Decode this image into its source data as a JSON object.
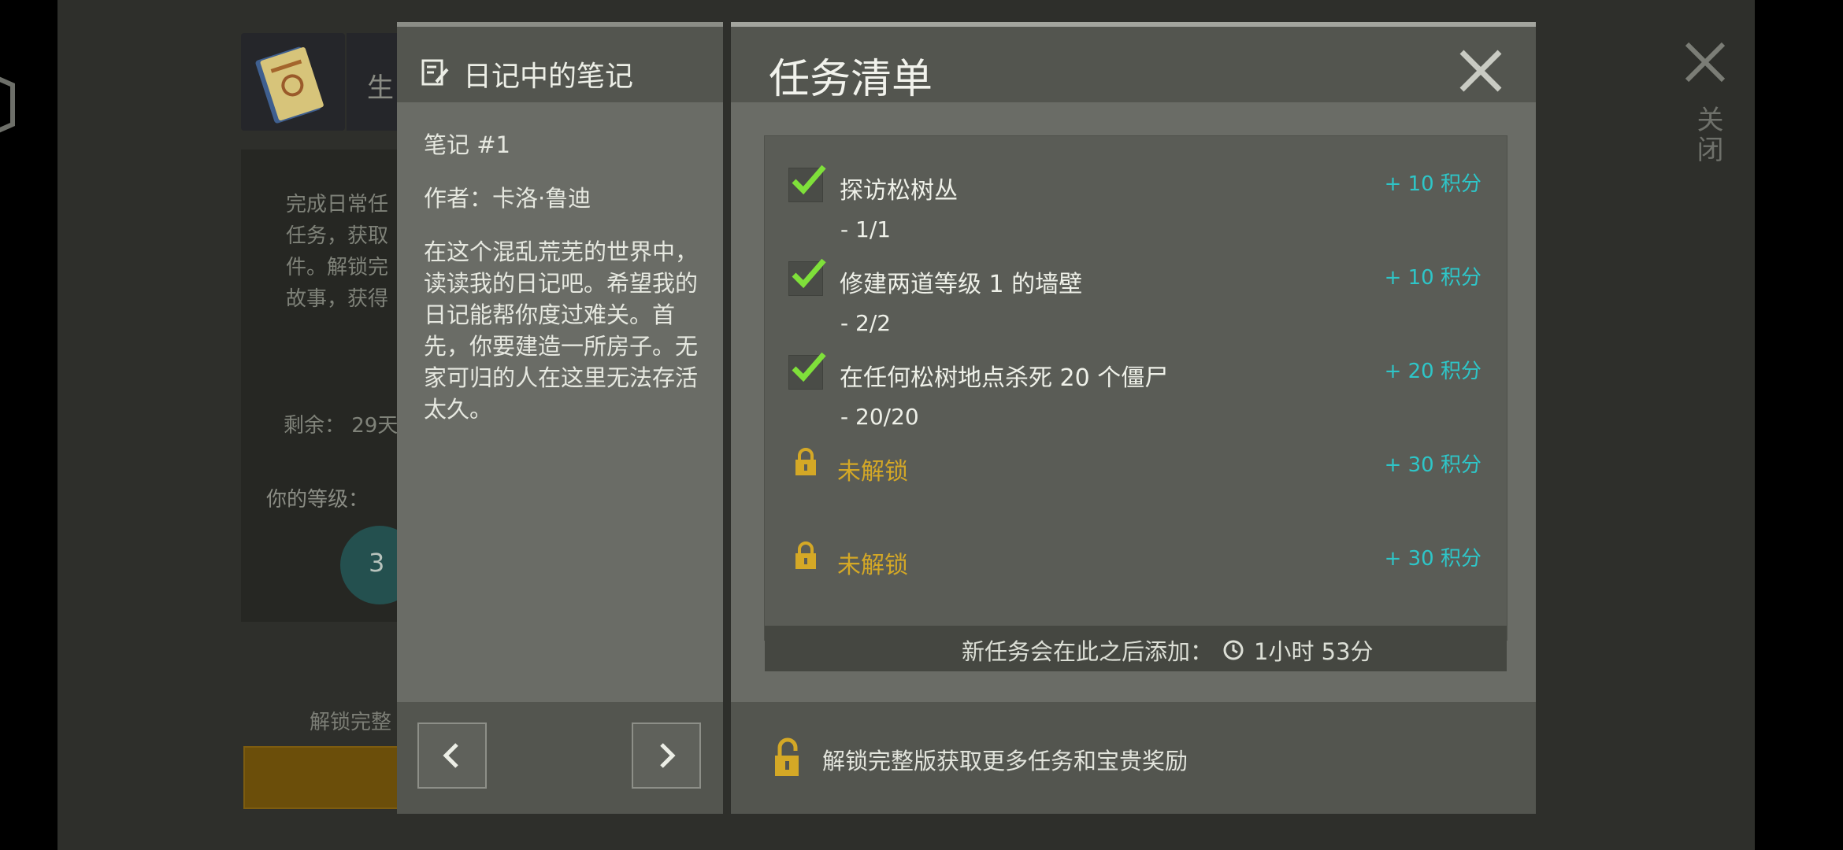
{
  "background": {
    "title": "生",
    "description": "完成日常任\n任务，获取\n件。解锁完\n故事，获得",
    "remaining": "剩余： 29天",
    "level_label": "你的等级：",
    "level_value": "3",
    "unlock_text": "解锁完整"
  },
  "right_close": {
    "label": "关闭"
  },
  "diary": {
    "title": "日记中的笔记",
    "note_number": "笔记 #1",
    "author": "作者：卡洛·鲁迪",
    "content": "在这个混乱荒芜的世界中，读读我的日记吧。希望我的日记能帮你度过难关。首先，你要建造一所房子。无家可归的人在这里无法存活太久。"
  },
  "task_list": {
    "title": "任务清单",
    "tasks": [
      {
        "label": "探访松树丛",
        "progress": "- 1/1",
        "reward": "+ 10  积分"
      },
      {
        "label": "修建两道等级 1 的墙壁",
        "progress": "- 2/2",
        "reward": "+ 10  积分"
      },
      {
        "label": "在任何松树地点杀死 20 个僵尸",
        "progress": "- 20/20",
        "reward": "+ 20  积分"
      }
    ],
    "locked": [
      {
        "label": "未解锁",
        "reward": "+ 30  积分"
      },
      {
        "label": "未解锁",
        "reward": "+ 30  积分"
      }
    ],
    "footer": {
      "text": "新任务会在此之后添加：",
      "time": "1小时 53分"
    },
    "unlock_full": "解锁完整版获取更多任务和宝贵奖励"
  },
  "colors": {
    "reward": "#2ec6c8",
    "locked": "#d4a826",
    "check": "#7fe03a"
  }
}
